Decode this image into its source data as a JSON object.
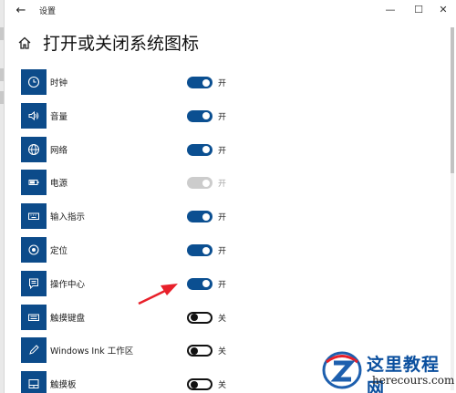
{
  "window": {
    "title": "设置",
    "back_glyph": "←",
    "minimize_glyph": "—",
    "maximize_glyph": "☐",
    "close_glyph": "✕"
  },
  "page": {
    "title": "打开或关闭系统图标"
  },
  "rows": [
    {
      "label": "时钟",
      "state": "开",
      "toggle": "on",
      "icon": "clock-icon"
    },
    {
      "label": "音量",
      "state": "开",
      "toggle": "on",
      "icon": "volume-icon"
    },
    {
      "label": "网络",
      "state": "开",
      "toggle": "on",
      "icon": "network-icon"
    },
    {
      "label": "电源",
      "state": "开",
      "toggle": "disabled",
      "icon": "battery-icon"
    },
    {
      "label": "输入指示",
      "state": "开",
      "toggle": "on",
      "icon": "keyboard-icon"
    },
    {
      "label": "定位",
      "state": "开",
      "toggle": "on",
      "icon": "location-icon"
    },
    {
      "label": "操作中心",
      "state": "开",
      "toggle": "on",
      "icon": "action-center-icon"
    },
    {
      "label": "触摸键盘",
      "state": "关",
      "toggle": "off",
      "icon": "touch-keyboard-icon"
    },
    {
      "label": "Windows Ink 工作区",
      "state": "关",
      "toggle": "off",
      "icon": "pen-icon"
    },
    {
      "label": "触摸板",
      "state": "关",
      "toggle": "off",
      "icon": "touchpad-icon"
    }
  ],
  "watermark": {
    "title": "这里教程网",
    "site": "herecours.com"
  },
  "colors": {
    "accent": "#0b4f91",
    "icon_bg": "#0c4b8a",
    "disabled": "#cccccc",
    "arrow": "#e8202a",
    "watermark_blue": "#0a4f9e"
  }
}
